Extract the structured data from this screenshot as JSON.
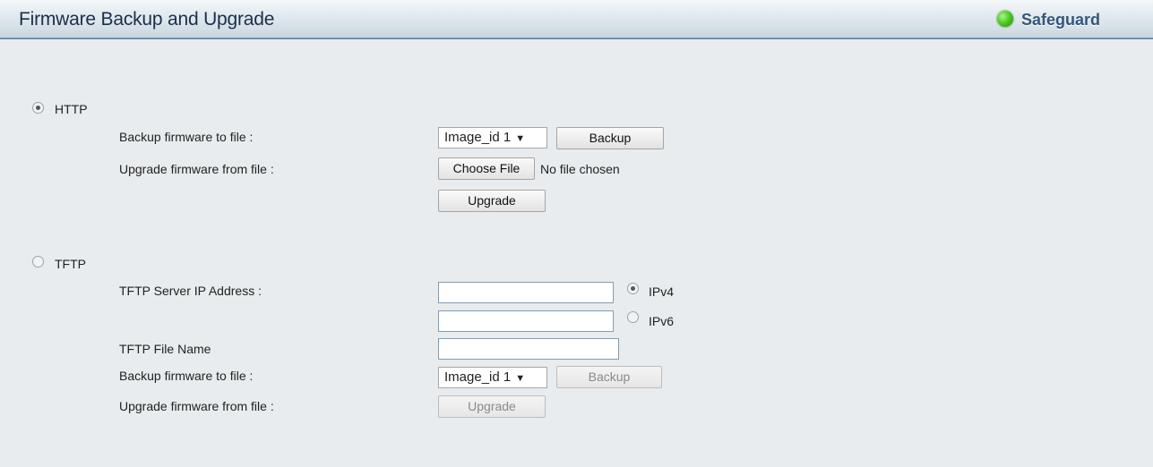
{
  "header": {
    "title": "Firmware Backup and Upgrade",
    "safeguard_label": "Safeguard"
  },
  "http": {
    "radio_label": "HTTP",
    "selected": true,
    "backup_label": "Backup firmware to file :",
    "backup_select_value": "Image_id 1",
    "backup_button": "Backup",
    "upgrade_label": "Upgrade firmware from file :",
    "choose_file_button": "Choose File",
    "file_status": "No file chosen",
    "upgrade_button": "Upgrade"
  },
  "tftp": {
    "radio_label": "TFTP",
    "selected": false,
    "server_ip_label": "TFTP Server IP Address :",
    "ipv4_label": "IPv4",
    "ipv6_label": "IPv6",
    "ipv4_value": "",
    "ipv6_value": "",
    "file_name_label": "TFTP File Name",
    "file_name_value": "",
    "backup_label": "Backup firmware to file :",
    "backup_select_value": "Image_id 1",
    "backup_button": "Backup",
    "upgrade_label": "Upgrade firmware from file :",
    "upgrade_button": "Upgrade"
  },
  "colors": {
    "header_border": "#6e94b3",
    "status_green": "#49c51c",
    "background": "#e8ecee"
  },
  "icons": [
    "status-green-dot-icon",
    "dropdown-arrow-icon"
  ]
}
